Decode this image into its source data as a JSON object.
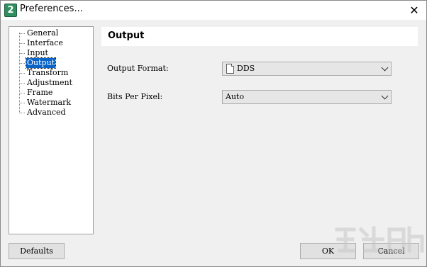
{
  "window": {
    "title": "Preferences...",
    "app_icon_glyph": "2",
    "close_glyph": "✕"
  },
  "sidebar": {
    "items": [
      {
        "label": "General"
      },
      {
        "label": "Interface"
      },
      {
        "label": "Input"
      },
      {
        "label": "Output",
        "selected": true
      },
      {
        "label": "Transform"
      },
      {
        "label": "Adjustment"
      },
      {
        "label": "Frame"
      },
      {
        "label": "Watermark"
      },
      {
        "label": "Advanced"
      }
    ]
  },
  "panel": {
    "title": "Output",
    "output_format": {
      "label": "Output Format:",
      "value": "DDS",
      "icon": "file-icon"
    },
    "bits_per_pixel": {
      "label": "Bits Per Pixel:",
      "value": "Auto"
    }
  },
  "buttons": {
    "defaults": "Defaults",
    "ok": "OK",
    "cancel": "Cancel"
  },
  "colors": {
    "selection": "#0a64c8",
    "window_bg": "#f0f0f0"
  }
}
